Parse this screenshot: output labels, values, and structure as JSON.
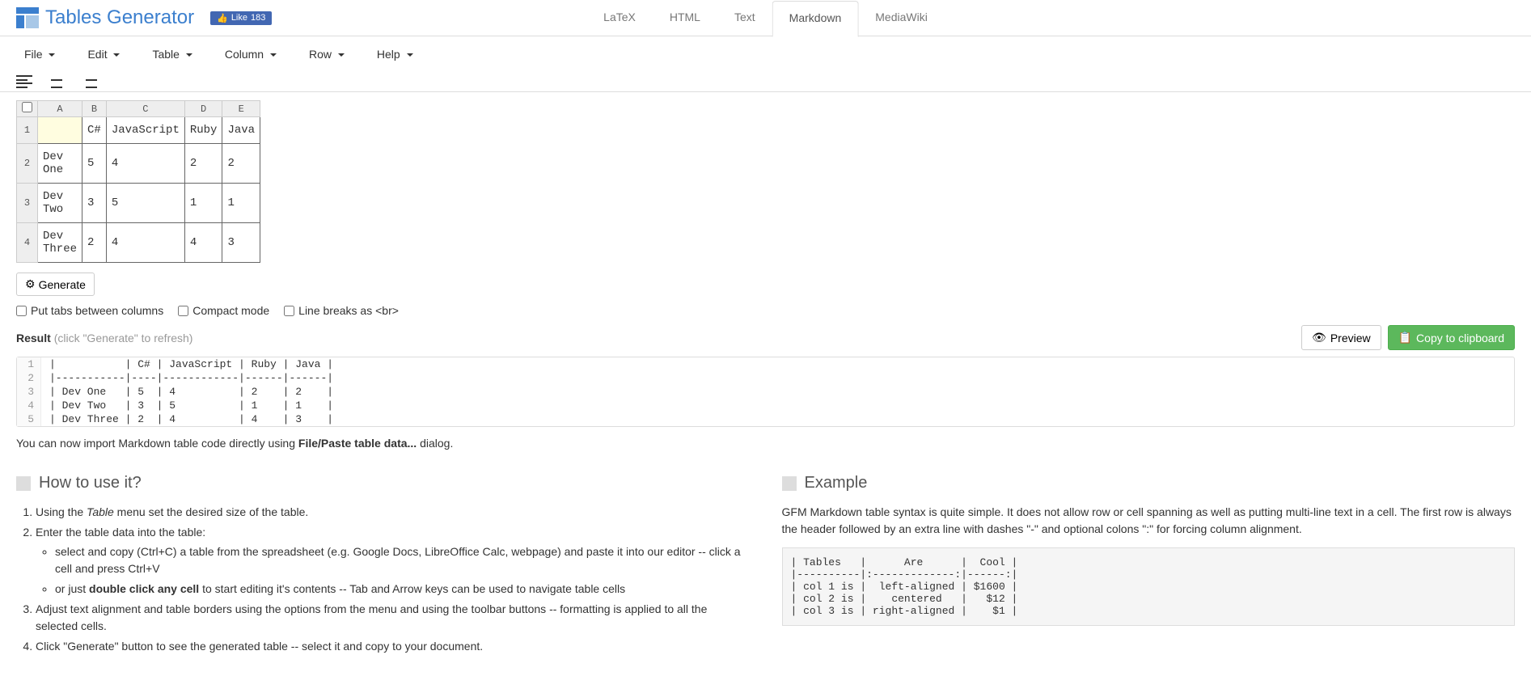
{
  "brand": {
    "name": "Tables Generator",
    "like_label": "Like",
    "like_count": "183"
  },
  "topnav": {
    "items": [
      "LaTeX",
      "HTML",
      "Text",
      "Markdown",
      "MediaWiki"
    ],
    "active": 3
  },
  "menubar": [
    "File",
    "Edit",
    "Table",
    "Column",
    "Row",
    "Help"
  ],
  "grid": {
    "col_headers": [
      "A",
      "B",
      "C",
      "D",
      "E"
    ],
    "row_headers": [
      "1",
      "2",
      "3",
      "4"
    ],
    "rows": [
      [
        "",
        "C#",
        "JavaScript",
        "Ruby",
        "Java"
      ],
      [
        "Dev One",
        "5",
        "4",
        "2",
        "2"
      ],
      [
        "Dev Two",
        "3",
        "5",
        "1",
        "1"
      ],
      [
        "Dev Three",
        "2",
        "4",
        "4",
        "3"
      ]
    ],
    "selected": [
      0,
      0
    ]
  },
  "buttons": {
    "generate": "Generate",
    "preview": "Preview",
    "copy": "Copy to clipboard"
  },
  "options": {
    "tabs": "Put tabs between columns",
    "compact": "Compact mode",
    "br": "Line breaks as <br>"
  },
  "result": {
    "label": "Result",
    "hint": "(click \"Generate\" to refresh)",
    "lines": [
      "|           | C# | JavaScript | Ruby | Java |",
      "|-----------|----|------------|------|------|",
      "| Dev One   | 5  | 4          | 2    | 2    |",
      "| Dev Two   | 3  | 5          | 1    | 1    |",
      "| Dev Three | 2  | 4          | 4    | 3    |"
    ]
  },
  "import_note": {
    "pre": "You can now import Markdown table code directly using ",
    "bold": "File/Paste table data...",
    "post": " dialog."
  },
  "howto": {
    "title": "How to use it?",
    "items": [
      {
        "pre": "Using the ",
        "em": "Table",
        "post": " menu set the desired size of the table."
      },
      {
        "text": "Enter the table data into the table:",
        "sub": [
          "select and copy (Ctrl+C) a table from the spreadsheet (e.g. Google Docs, LibreOffice Calc, webpage) and paste it into our editor -- click a cell and press Ctrl+V",
          {
            "pre": "or just ",
            "bold": "double click any cell",
            "post": " to start editing it's contents -- Tab and Arrow keys can be used to navigate table cells"
          }
        ]
      },
      {
        "text": "Adjust text alignment and table borders using the options from the menu and using the toolbar buttons -- formatting is applied to all the selected cells."
      },
      {
        "text": "Click \"Generate\" button to see the generated table -- select it and copy to your document."
      }
    ]
  },
  "example": {
    "title": "Example",
    "desc": "GFM Markdown table syntax is quite simple. It does not allow row or cell spanning as well as putting multi-line text in a cell. The first row is always the header followed by an extra line with dashes \"-\" and optional colons \":\" for forcing column alignment.",
    "code": "| Tables   |      Are      |  Cool |\n|----------|:-------------:|------:|\n| col 1 is |  left-aligned | $1600 |\n| col 2 is |    centered   |   $12 |\n| col 3 is | right-aligned |    $1 |"
  }
}
